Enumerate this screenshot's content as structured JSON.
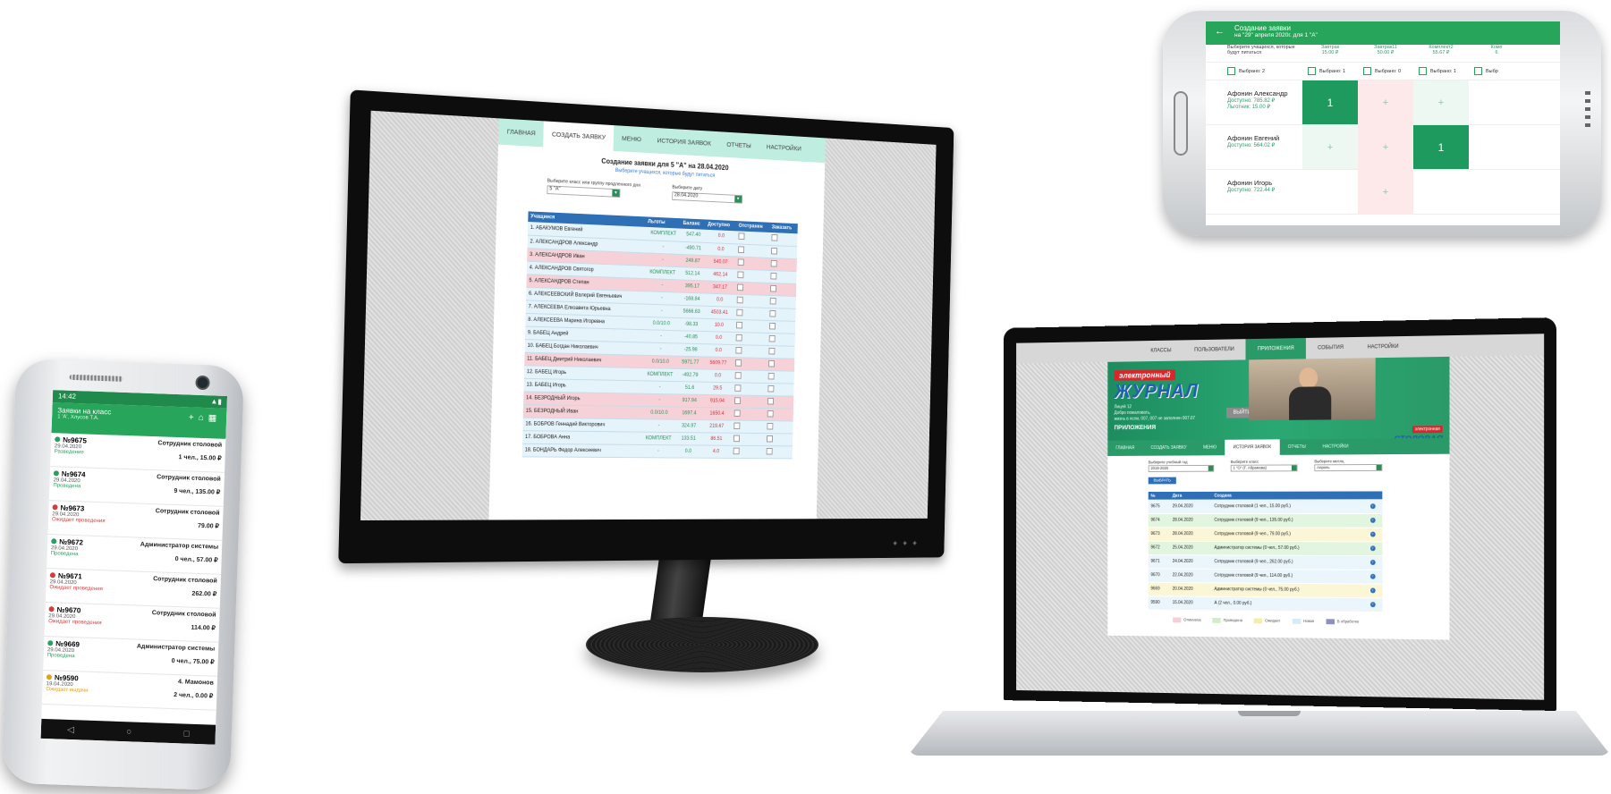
{
  "phone_left": {
    "status_time": "14:42",
    "header_title": "Заявки на класс",
    "header_sub": "1 'А', Хлусов Т.А.",
    "items": [
      {
        "num": "№9675",
        "date": "29.04.2020",
        "status": "Разведение",
        "who": "Сотрудник столовой",
        "amount": "1 чел., 15.00 ₽",
        "dot": "#2aa060"
      },
      {
        "num": "№9674",
        "date": "29.04.2020",
        "status": "Проведена",
        "who": "Сотрудник столовой",
        "amount": "9 чел., 135.00 ₽",
        "dot": "#2aa060"
      },
      {
        "num": "№9673",
        "date": "29.04.2020",
        "status": "Ожидает проведения",
        "who": "Сотрудник столовой",
        "amount": "79.00 ₽",
        "dot": "#d93a3a"
      },
      {
        "num": "№9672",
        "date": "29.04.2020",
        "status": "Проведена",
        "who": "Администратор системы",
        "amount": "0 чел., 57.00 ₽",
        "dot": "#2aa060"
      },
      {
        "num": "№9671",
        "date": "29.04.2020",
        "status": "Ожидает проведения",
        "who": "Сотрудник столовой",
        "amount": "262.00 ₽",
        "dot": "#d93a3a"
      },
      {
        "num": "№9670",
        "date": "29.04.2020",
        "status": "Ожидает проведения",
        "who": "Сотрудник столовой",
        "amount": "114.00 ₽",
        "dot": "#d93a3a"
      },
      {
        "num": "№9669",
        "date": "29.04.2020",
        "status": "Проведена",
        "who": "Администратор системы",
        "amount": "0 чел., 75.00 ₽",
        "dot": "#2aa060"
      },
      {
        "num": "№9590",
        "date": "19.04.2020",
        "status": "Ожидает выдачи",
        "who": "4. Мамонов",
        "amount": "2 чел., 0.00 ₽",
        "dot": "#e4a018"
      }
    ]
  },
  "monitor": {
    "nav": [
      "ГЛАВНАЯ",
      "СОЗДАТЬ ЗАЯВКУ",
      "МЕНЮ",
      "ИСТОРИЯ ЗАЯВОК",
      "ОТЧЕТЫ",
      "НАСТРОЙКИ"
    ],
    "title": "Создание заявки для 5 \"А\" на 28.04.2020",
    "subtitle": "Выберите учащихся, которые будут питаться",
    "class_label": "Выберите класс или группу продленного дня",
    "class_value": "5 \"А\"",
    "date_label": "Выберите дату",
    "date_value": "28.04.2020",
    "columns": [
      "Учащиеся",
      "Льготы",
      "Баланс",
      "Доступно",
      "Отстранен",
      "Заказать"
    ],
    "rows": [
      {
        "name": "1. АБАКУМОВ Евгений",
        "lg": "КОМПЛЕКТ",
        "bal": "547.40",
        "dost": "0.0",
        "style": "blue"
      },
      {
        "name": "2. АЛЕКСАНДРОВ Александр",
        "lg": "-",
        "bal": "-490.71",
        "dost": "0.0",
        "style": "blue"
      },
      {
        "name": "3. АЛЕКСАНДРОВ Иван",
        "lg": "-",
        "bal": "249.87",
        "dost": "540.07",
        "style": "pink"
      },
      {
        "name": "4. АЛЕКСАНДРОВ Святогор",
        "lg": "КОМПЛЕКТ",
        "bal": "512.14",
        "dost": "462.14",
        "style": "blue"
      },
      {
        "name": "5. АЛЕКСАНДРОВ Степан",
        "lg": "-",
        "bal": "395.17",
        "dost": "347.17",
        "style": "pink"
      },
      {
        "name": "6. АЛЕКСЕЕВСКИЙ Валерий Евгеньевич",
        "lg": "-",
        "bal": "-168.84",
        "dost": "0.0",
        "style": "blue"
      },
      {
        "name": "7. АЛЕКСЕЕВА Елизавета Юрьевна",
        "lg": "-",
        "bal": "5666.63",
        "dost": "4503.41",
        "style": "blue"
      },
      {
        "name": "8. АЛЕКСЕЕВА Марина Игоревна",
        "lg": "0.0/10.0",
        "bal": "-98.33",
        "dost": "10.0",
        "style": "blue"
      },
      {
        "name": "9. БАБЕЦ Андрей",
        "lg": "-",
        "bal": "-40.85",
        "dost": "0.0",
        "style": "blue"
      },
      {
        "name": "10. БАБЕЦ Богдан Николаевич",
        "lg": "-",
        "bal": "-25.98",
        "dost": "0.0",
        "style": "blue"
      },
      {
        "name": "11. БАБЕЦ Дмитрий Николаевич",
        "lg": "0.0/10.0",
        "bal": "5971.77",
        "dost": "5609.77",
        "style": "pink"
      },
      {
        "name": "12. БАБЕЦ Игорь",
        "lg": "КОМПЛЕКТ",
        "bal": "-492.79",
        "dost": "0.0",
        "style": "blue"
      },
      {
        "name": "13. БАБЕЦ Игорь",
        "lg": "-",
        "bal": "51.6",
        "dost": "29.5",
        "style": "blue"
      },
      {
        "name": "14. БЕЗРОДНЫЙ Игорь",
        "lg": "-",
        "bal": "917.94",
        "dost": "915.94",
        "style": "pink"
      },
      {
        "name": "15. БЕЗРОДНЫЙ Иван",
        "lg": "0.0/10.0",
        "bal": "1697.4",
        "dost": "1650.4",
        "style": "pink"
      },
      {
        "name": "16. БОБРОВ Геннадий Викторович",
        "lg": "-",
        "bal": "324.97",
        "dost": "219.67",
        "style": "blue"
      },
      {
        "name": "17. БОБРОВА Анна",
        "lg": "КОМПЛЕКТ",
        "bal": "133.51",
        "dost": "86.51",
        "style": "blue"
      },
      {
        "name": "18. БОНДАРЬ Федор Алексеевич",
        "lg": "-",
        "bal": "0.0",
        "dost": "4.0",
        "style": "blue"
      }
    ]
  },
  "laptop": {
    "top_nav": [
      "КЛАССЫ",
      "ПОЛЬЗОВАТЕЛИ",
      "ПРИЛОЖЕНИЯ",
      "СОБЫТИЯ",
      "НАСТРОЙКИ"
    ],
    "logo_top": "электронный",
    "logo_bottom": "ЖУРНАЛ",
    "user_lines": [
      "Лицей 12",
      "Добро пожаловать,",
      "жизнь в ясли, 007, 007 не заполнен 007.07"
    ],
    "logout": "ВЫЙТИ",
    "apps_title": "ПРИЛОЖЕНИЯ",
    "logo3_top": "электронная",
    "logo3_bottom": "СТОЛОВАЯ",
    "sub_nav": [
      "ГЛАВНАЯ",
      "СОЗДАТЬ ЗАЯВКУ",
      "МЕНЮ",
      "ИСТОРИЯ ЗАЯВОК",
      "ОТЧЕТЫ",
      "НАСТРОЙКИ"
    ],
    "filter1_label": "Выберите учебный год",
    "filter1_value": "2019-2020",
    "filter2_label": "Выберите класс",
    "filter2_value": "1 \"О\" (Г. Абрамова)",
    "filter3_label": "Выберите месяц",
    "filter3_value": "Апрель",
    "button": "ВЫБРАТЬ",
    "columns": [
      "№",
      "Дата",
      "Создана"
    ],
    "rows": [
      {
        "n": "9675",
        "d": "29.04.2020",
        "c": "Сотрудник столовой (1 чел., 15.00 руб.)",
        "bg": "#eaf6fb"
      },
      {
        "n": "9674",
        "d": "28.04.2020",
        "c": "Сотрудник столовой (9 чел., 135.00 руб.)",
        "bg": "#e2f5df"
      },
      {
        "n": "9673",
        "d": "28.04.2020",
        "c": "Сотрудник столовой (9 чел., 79.00 руб.)",
        "bg": "#fbf6d6"
      },
      {
        "n": "9672",
        "d": "25.04.2020",
        "c": "Администратор системы (0 чел., 57.00 руб.)",
        "bg": "#e2f5df"
      },
      {
        "n": "9671",
        "d": "24.04.2020",
        "c": "Сотрудник столовой (9 чел., 262.00 руб.)",
        "bg": "#eaf6fb"
      },
      {
        "n": "9670",
        "d": "22.04.2020",
        "c": "Сотрудник столовой (9 чел., 114.00 руб.)",
        "bg": "#eaf6fb"
      },
      {
        "n": "9669",
        "d": "20.04.2020",
        "c": "Администратор системы (0 чел., 75.00 руб.)",
        "bg": "#fbf6d6"
      },
      {
        "n": "9590",
        "d": "15.04.2020",
        "c": "А (2 чел., 0.00 руб.)",
        "bg": "#eaf6fb"
      }
    ],
    "legend": [
      {
        "label": "Отменена",
        "color": "#f6cfd6"
      },
      {
        "label": "Проведена",
        "color": "#cdeec7"
      },
      {
        "label": "Ожидает",
        "color": "#f5ecb0"
      },
      {
        "label": "Новая",
        "color": "#d3ecf7"
      },
      {
        "label": "В обработке",
        "color": "#8f8fc4"
      }
    ]
  },
  "phone_right": {
    "title": "Создание заявки",
    "subtitle": "на \"29\" апреля 2020г. для 1 \"А\"",
    "hint": "Выберите учащихся, которые будут питаться",
    "columns": [
      {
        "name": "Завтрак",
        "price": "15.00 ₽"
      },
      {
        "name": "Завтрак11",
        "price": "50.00 ₽"
      },
      {
        "name": "Комплект2",
        "price": "55.67 ₽"
      },
      {
        "name": "Комп",
        "price": "6"
      }
    ],
    "selected_total": "Выбрано: 2",
    "selected_cols": [
      "Выбрано: 1",
      "Выбрано: 0",
      "Выбрано: 1",
      "Выбр"
    ],
    "persons": [
      {
        "name": "Афонин Александр",
        "bal1": "Доступно: 785.82 ₽",
        "bal2": "Льготник: 15.00 ₽",
        "cells": [
          "1",
          "+",
          "+"
        ],
        "styles": [
          "sel",
          "pink",
          "green"
        ]
      },
      {
        "name": "Афонин Евгений",
        "bal1": "Доступно: 564.02 ₽",
        "bal2": "",
        "cells": [
          "+",
          "+",
          "1"
        ],
        "styles": [
          "green",
          "pink",
          "sel"
        ]
      },
      {
        "name": "Афонин Игорь",
        "bal1": "Доступно: 722.44 ₽",
        "bal2": "",
        "cells": [
          "",
          "+",
          ""
        ],
        "styles": [
          "",
          "pink",
          ""
        ]
      }
    ]
  }
}
